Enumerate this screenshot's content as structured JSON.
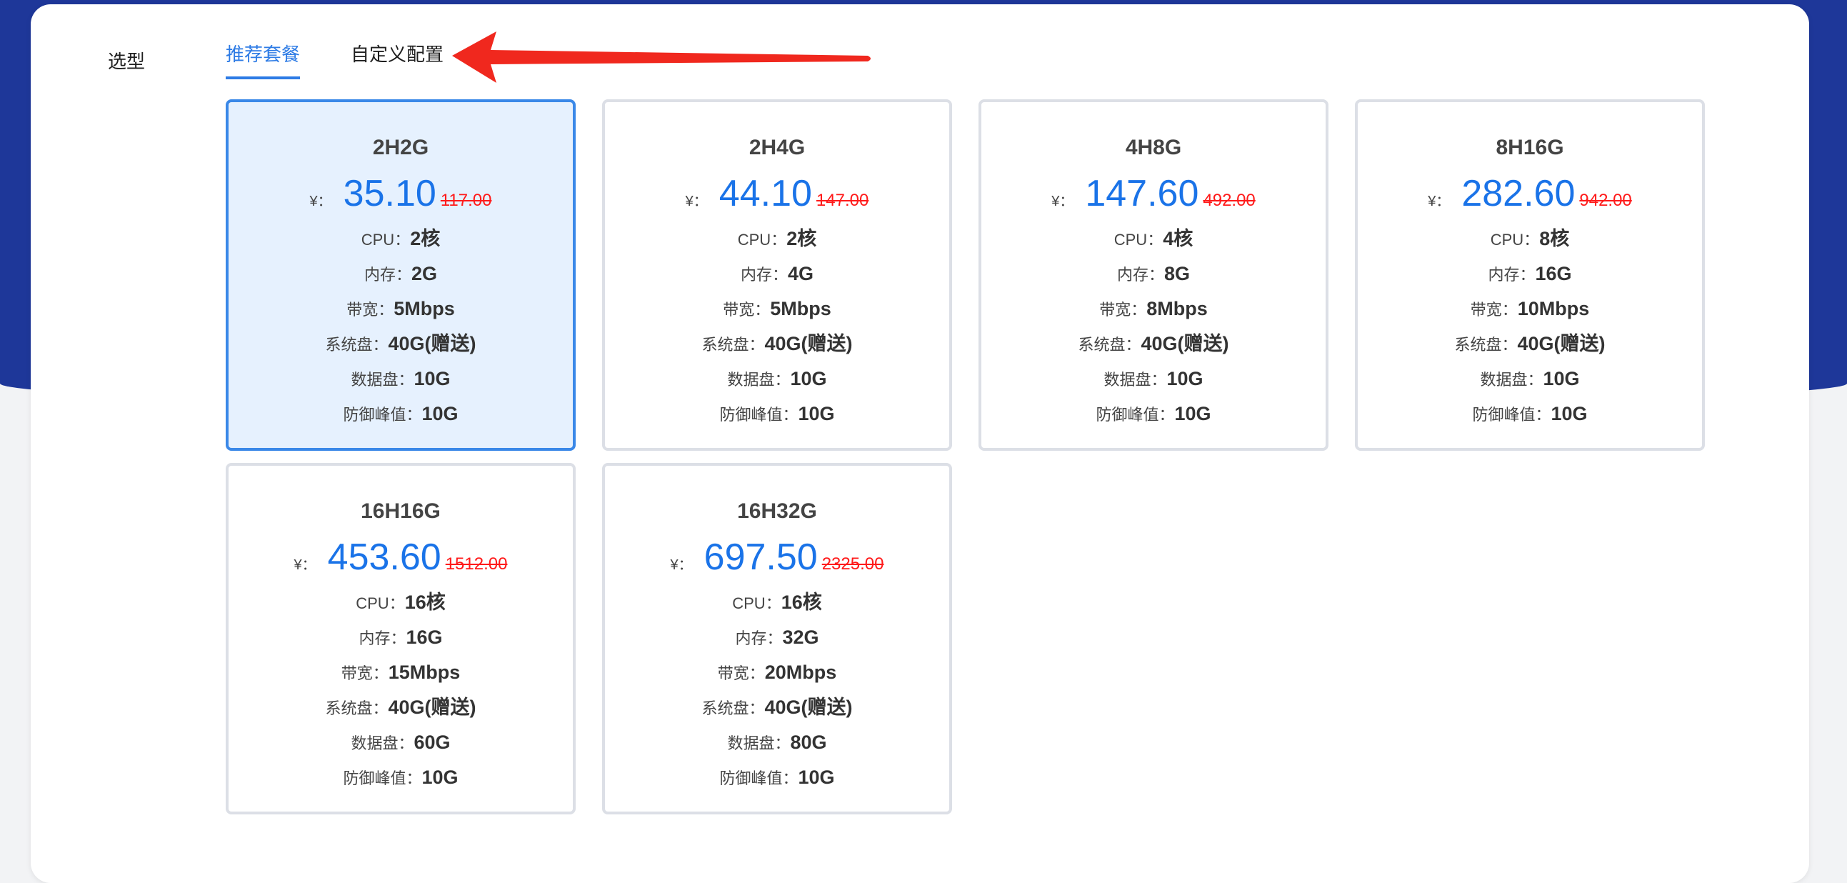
{
  "section_label": "选型",
  "tabs": [
    {
      "label": "推荐套餐",
      "active": true
    },
    {
      "label": "自定义配置",
      "active": false
    }
  ],
  "colors": {
    "accent": "#2d7be5",
    "price": "#1a73e8",
    "original_price": "#ff1a1a",
    "annotation_arrow": "#f0281e",
    "header_bg": "#1e3799"
  },
  "currency": "¥：",
  "spec_labels": {
    "cpu": "CPU：",
    "memory": "内存：",
    "bandwidth": "带宽：",
    "system_disk": "系统盘：",
    "data_disk": "数据盘：",
    "ddos": "防御峰值："
  },
  "plans": [
    {
      "name": "2H2G",
      "price": "35.10",
      "original": "117.00",
      "cpu": "2核",
      "memory": "2G",
      "bandwidth": "5Mbps",
      "system_disk": "40G(赠送)",
      "data_disk": "10G",
      "ddos": "10G",
      "selected": true
    },
    {
      "name": "2H4G",
      "price": "44.10",
      "original": "147.00",
      "cpu": "2核",
      "memory": "4G",
      "bandwidth": "5Mbps",
      "system_disk": "40G(赠送)",
      "data_disk": "10G",
      "ddos": "10G",
      "selected": false
    },
    {
      "name": "4H8G",
      "price": "147.60",
      "original": "492.00",
      "cpu": "4核",
      "memory": "8G",
      "bandwidth": "8Mbps",
      "system_disk": "40G(赠送)",
      "data_disk": "10G",
      "ddos": "10G",
      "selected": false
    },
    {
      "name": "8H16G",
      "price": "282.60",
      "original": "942.00",
      "cpu": "8核",
      "memory": "16G",
      "bandwidth": "10Mbps",
      "system_disk": "40G(赠送)",
      "data_disk": "10G",
      "ddos": "10G",
      "selected": false
    },
    {
      "name": "16H16G",
      "price": "453.60",
      "original": "1512.00",
      "cpu": "16核",
      "memory": "16G",
      "bandwidth": "15Mbps",
      "system_disk": "40G(赠送)",
      "data_disk": "60G",
      "ddos": "10G",
      "selected": false
    },
    {
      "name": "16H32G",
      "price": "697.50",
      "original": "2325.00",
      "cpu": "16核",
      "memory": "32G",
      "bandwidth": "20Mbps",
      "system_disk": "40G(赠送)",
      "data_disk": "80G",
      "ddos": "10G",
      "selected": false
    }
  ]
}
